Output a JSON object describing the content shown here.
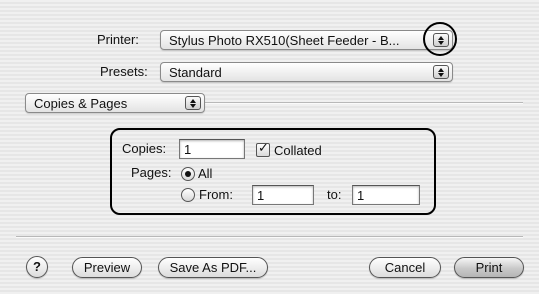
{
  "printer": {
    "label": "Printer:",
    "value": "Stylus Photo RX510(Sheet Feeder - B..."
  },
  "presets": {
    "label": "Presets:",
    "value": "Standard"
  },
  "section": {
    "value": "Copies & Pages"
  },
  "copies": {
    "label": "Copies:",
    "value": "1",
    "collated_label": "Collated",
    "collated_checked": true
  },
  "pages": {
    "label": "Pages:",
    "all_label": "All",
    "all_selected": true,
    "from_label": "From:",
    "from_value": "1",
    "to_label": "to:",
    "to_value": "1"
  },
  "buttons": {
    "help": "?",
    "preview": "Preview",
    "save_as_pdf": "Save As PDF...",
    "cancel": "Cancel",
    "print": "Print"
  }
}
